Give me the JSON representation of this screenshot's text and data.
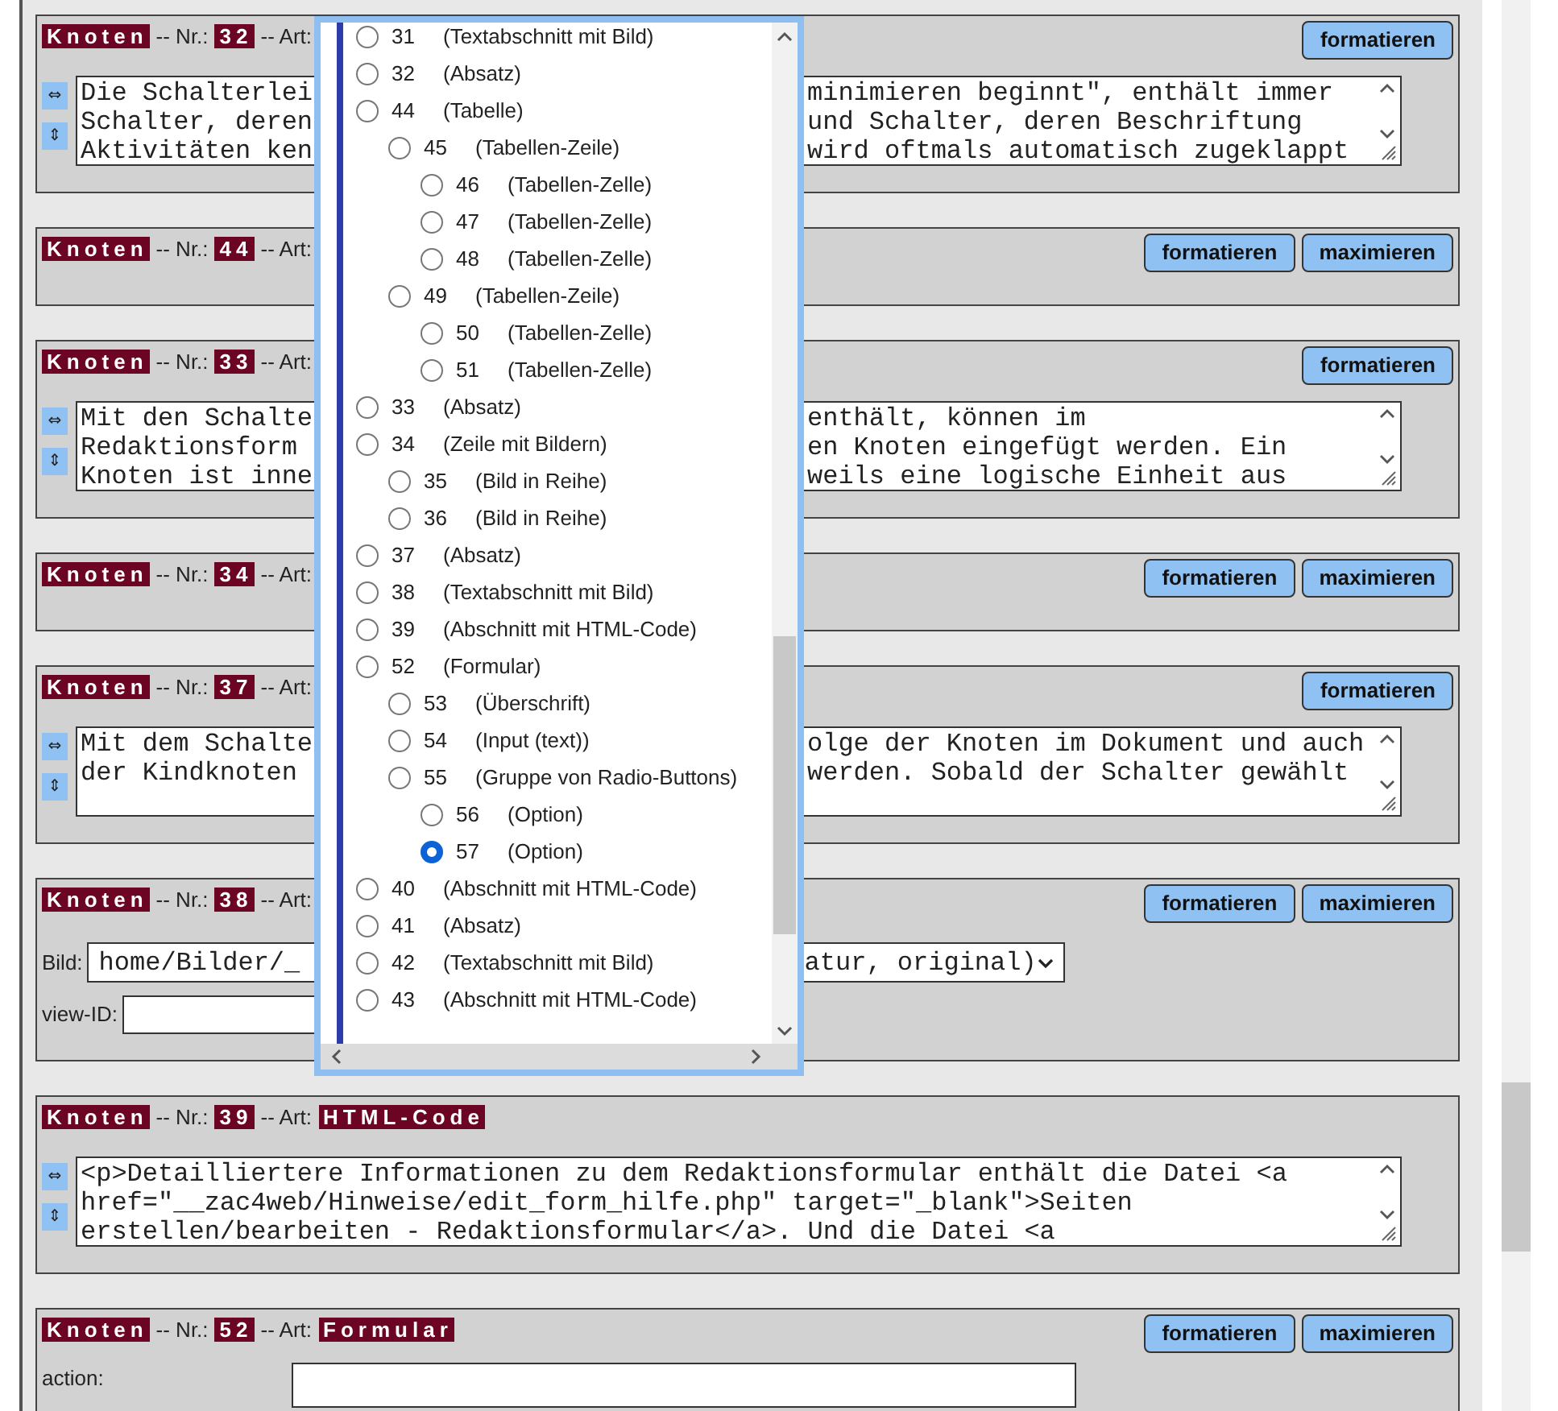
{
  "nodes": [
    {
      "kind": "text",
      "label": "Knoten",
      "nr_label": "-- Nr.:",
      "nr": "32",
      "art_label": "-- Art:",
      "buttons": [
        "formatieren"
      ],
      "side_buttons": [
        "⇔",
        "⇕"
      ],
      "lines": [
        {
          "left": "Die Schalterlei",
          "right": "minimieren beginnt\", enthält immer"
        },
        {
          "left": "Schalter, deren",
          "right": "und Schalter, deren Beschriftung"
        },
        {
          "left": "Aktivitäten ken",
          "right": "wird oftmals automatisch zugeklappt"
        }
      ]
    },
    {
      "kind": "empty",
      "label": "Knoten",
      "nr_label": "-- Nr.:",
      "nr": "44",
      "art_label": "-- Art:",
      "buttons": [
        "formatieren",
        "maximieren"
      ]
    },
    {
      "kind": "text",
      "label": "Knoten",
      "nr_label": "-- Nr.:",
      "nr": "33",
      "art_label": "-- Art:",
      "buttons": [
        "formatieren"
      ],
      "side_buttons": [
        "⇔",
        "⇕"
      ],
      "lines": [
        {
          "left": "Mit den Schalte",
          "right": "enthält, können im"
        },
        {
          "left": "Redaktionsform",
          "right": "en Knoten eingefügt werden. Ein"
        },
        {
          "left": "Knoten ist inne",
          "right": "weils eine logische Einheit aus"
        }
      ]
    },
    {
      "kind": "empty",
      "label": "Knoten",
      "nr_label": "-- Nr.:",
      "nr": "34",
      "art_label": "-- Art:",
      "buttons": [
        "formatieren",
        "maximieren"
      ]
    },
    {
      "kind": "text",
      "label": "Knoten",
      "nr_label": "-- Nr.:",
      "nr": "37",
      "art_label": "-- Art:",
      "buttons": [
        "formatieren"
      ],
      "side_buttons": [
        "⇔",
        "⇕"
      ],
      "lines": [
        {
          "left": "Mit dem Schalte",
          "right": "olge der Knoten im Dokument und auch"
        },
        {
          "left": "der Kindknoten",
          "right": "werden. Sobald der Schalter gewählt"
        }
      ]
    },
    {
      "kind": "image",
      "label": "Knoten",
      "nr_label": "-- Nr.:",
      "nr": "38",
      "art_label": "-- Art:",
      "buttons": [
        "formatieren",
        "maximieren"
      ],
      "image_label": "Bild:",
      "image_left": "home/Bilder/_",
      "image_right": "atur, original)",
      "view_label": "view-ID:"
    },
    {
      "kind": "text",
      "label": "Knoten",
      "nr_label": "-- Nr.:",
      "nr": "39",
      "art_label": "-- Art:",
      "art": "HTML-Code",
      "side_buttons": [
        "⇔",
        "⇕"
      ],
      "lines": [
        {
          "full": "<p>Detailliertere Informationen zu dem Redaktionsformular enthält die Datei <a"
        },
        {
          "full": "href=\"__zac4web/Hinweise/edit_form_hilfe.php\" target=\"_blank\">Seiten"
        },
        {
          "full": "erstellen/bearbeiten - Redaktionsformular</a>. Und die Datei <a"
        }
      ]
    },
    {
      "kind": "form",
      "label": "Knoten",
      "nr_label": "-- Nr.:",
      "nr": "52",
      "art_label": "-- Art:",
      "art": "Formular",
      "buttons": [
        "formatieren",
        "maximieren"
      ],
      "action_label": "action:"
    }
  ],
  "node_tree": [
    {
      "nr": "31",
      "type": "(Textabschnitt mit Bild)",
      "selected": false
    },
    {
      "nr": "32",
      "type": "(Absatz)",
      "selected": false
    },
    {
      "nr": "44",
      "type": "(Tabelle)",
      "selected": false,
      "children": [
        {
          "nr": "45",
          "type": "(Tabellen-Zeile)",
          "selected": false,
          "children": [
            {
              "nr": "46",
              "type": "(Tabellen-Zelle)",
              "selected": false
            },
            {
              "nr": "47",
              "type": "(Tabellen-Zelle)",
              "selected": false
            },
            {
              "nr": "48",
              "type": "(Tabellen-Zelle)",
              "selected": false
            }
          ]
        },
        {
          "nr": "49",
          "type": "(Tabellen-Zeile)",
          "selected": false,
          "children": [
            {
              "nr": "50",
              "type": "(Tabellen-Zelle)",
              "selected": false
            },
            {
              "nr": "51",
              "type": "(Tabellen-Zelle)",
              "selected": false
            }
          ]
        }
      ]
    },
    {
      "nr": "33",
      "type": "(Absatz)",
      "selected": false
    },
    {
      "nr": "34",
      "type": "(Zeile mit Bildern)",
      "selected": false,
      "children": [
        {
          "nr": "35",
          "type": "(Bild in Reihe)",
          "selected": false
        },
        {
          "nr": "36",
          "type": "(Bild in Reihe)",
          "selected": false
        }
      ]
    },
    {
      "nr": "37",
      "type": "(Absatz)",
      "selected": false
    },
    {
      "nr": "38",
      "type": "(Textabschnitt mit Bild)",
      "selected": false
    },
    {
      "nr": "39",
      "type": "(Abschnitt mit HTML-Code)",
      "selected": false
    },
    {
      "nr": "52",
      "type": "(Formular)",
      "selected": false,
      "children": [
        {
          "nr": "53",
          "type": "(Überschrift)",
          "selected": false
        },
        {
          "nr": "54",
          "type": "(Input (text))",
          "selected": false
        },
        {
          "nr": "55",
          "type": "(Gruppe von Radio-Buttons)",
          "selected": false,
          "children": [
            {
              "nr": "56",
              "type": "(Option)",
              "selected": false
            },
            {
              "nr": "57",
              "type": "(Option)",
              "selected": true
            }
          ]
        }
      ]
    },
    {
      "nr": "40",
      "type": "(Abschnitt mit HTML-Code)",
      "selected": false
    },
    {
      "nr": "41",
      "type": "(Absatz)",
      "selected": false
    },
    {
      "nr": "42",
      "type": "(Textabschnitt mit Bild)",
      "selected": false
    },
    {
      "nr": "43",
      "type": "(Abschnitt mit HTML-Code)",
      "selected": false
    }
  ]
}
